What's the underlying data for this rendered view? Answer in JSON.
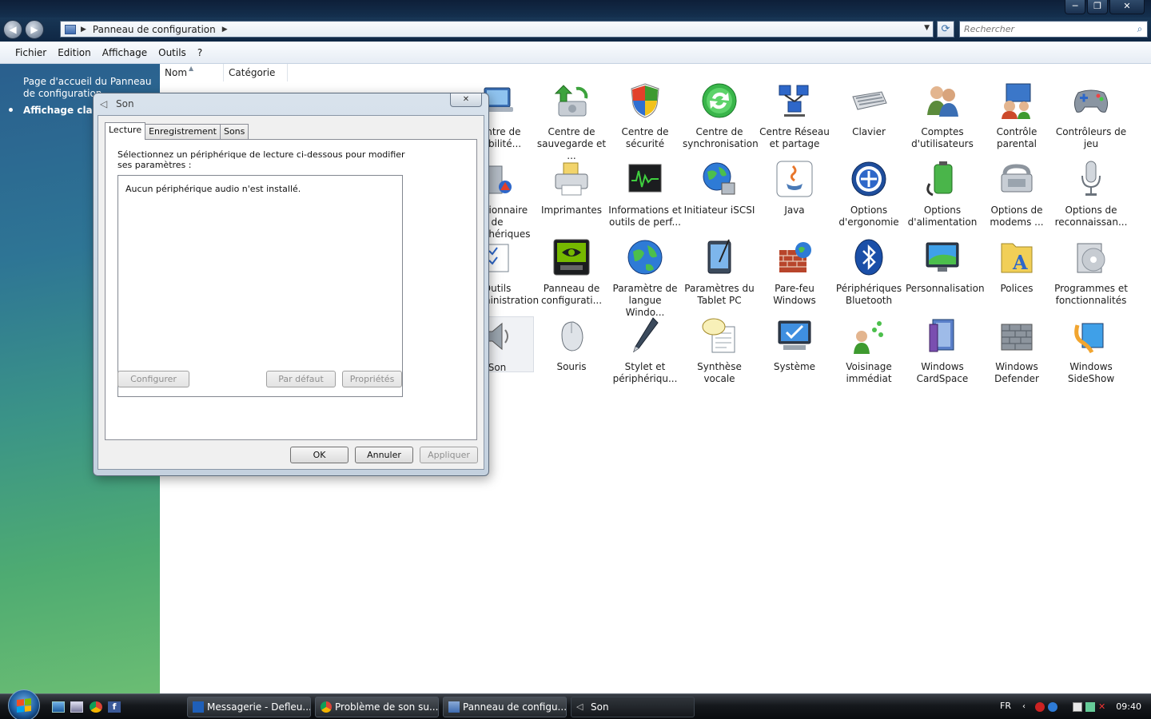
{
  "window": {
    "controls": [
      "─",
      "❐",
      "✕"
    ]
  },
  "address": {
    "path": "Panneau de configuration",
    "search_placeholder": "Rechercher"
  },
  "menu": [
    "Fichier",
    "Edition",
    "Affichage",
    "Outils",
    "?"
  ],
  "sidebar": {
    "home_link": "Page d'accueil du Panneau de configuration",
    "classic_view": "Affichage classique"
  },
  "columns": [
    "Nom",
    "Catégorie"
  ],
  "items": [
    {
      "label": "Centre de mobilité...",
      "icon": "mobility-center-icon"
    },
    {
      "label": "Centre de sauvegarde et ...",
      "icon": "backup-center-icon"
    },
    {
      "label": "Centre de sécurité",
      "icon": "security-shield-icon"
    },
    {
      "label": "Centre de synchronisation",
      "icon": "sync-center-icon"
    },
    {
      "label": "Centre Réseau et partage",
      "icon": "network-center-icon"
    },
    {
      "label": "Clavier",
      "icon": "keyboard-icon"
    },
    {
      "label": "Comptes d'utilisateurs",
      "icon": "user-accounts-icon"
    },
    {
      "label": "Contrôle parental",
      "icon": "parental-control-icon"
    },
    {
      "label": "Contrôleurs de jeu",
      "icon": "gamepad-icon"
    },
    {
      "label": "Gestionnaire de périphériques",
      "icon": "device-manager-icon"
    },
    {
      "label": "Imprimantes",
      "icon": "printer-icon"
    },
    {
      "label": "Informations et outils de perf...",
      "icon": "performance-icon"
    },
    {
      "label": "Initiateur iSCSI",
      "icon": "iscsi-globe-icon"
    },
    {
      "label": "Java",
      "icon": "java-icon"
    },
    {
      "label": "Options d'ergonomie",
      "icon": "ease-of-access-icon"
    },
    {
      "label": "Options d'alimentation",
      "icon": "power-options-icon"
    },
    {
      "label": "Options de modems ...",
      "icon": "modem-phone-icon"
    },
    {
      "label": "Options de reconnaissan...",
      "icon": "microphone-icon"
    },
    {
      "label": "Outils d'administration",
      "icon": "admin-tools-icon"
    },
    {
      "label": "Panneau de configurati...",
      "icon": "nvidia-panel-icon"
    },
    {
      "label": "Paramètre de langue Windo...",
      "icon": "language-globe-icon"
    },
    {
      "label": "Paramètres du Tablet PC",
      "icon": "tablet-pc-icon"
    },
    {
      "label": "Pare-feu Windows",
      "icon": "firewall-icon"
    },
    {
      "label": "Périphériques Bluetooth",
      "icon": "bluetooth-icon"
    },
    {
      "label": "Personnalisation",
      "icon": "personalization-icon"
    },
    {
      "label": "Polices",
      "icon": "fonts-folder-icon"
    },
    {
      "label": "Programmes et fonctionnalités",
      "icon": "programs-icon"
    },
    {
      "label": "Son",
      "icon": "speaker-icon"
    },
    {
      "label": "Souris",
      "icon": "mouse-icon"
    },
    {
      "label": "Stylet et périphériqu...",
      "icon": "pen-icon"
    },
    {
      "label": "Synthèse vocale",
      "icon": "speech-icon"
    },
    {
      "label": "Système",
      "icon": "system-icon"
    },
    {
      "label": "Voisinage immédiat",
      "icon": "people-near-me-icon"
    },
    {
      "label": "Windows CardSpace",
      "icon": "cardspace-icon"
    },
    {
      "label": "Windows Defender",
      "icon": "defender-wall-icon"
    },
    {
      "label": "Windows SideShow",
      "icon": "sideshow-icon"
    }
  ],
  "dialog": {
    "title": "Son",
    "close_label": "✕",
    "tabs": [
      "Lecture",
      "Enregistrement",
      "Sons"
    ],
    "instruction": "Sélectionnez un périphérique de lecture ci-dessous pour modifier ses paramètres :",
    "empty_message": "Aucun périphérique audio n'est installé.",
    "buttons": {
      "configure": "Configurer",
      "default": "Par défaut",
      "properties": "Propriétés",
      "ok": "OK",
      "cancel": "Annuler",
      "apply": "Appliquer"
    }
  },
  "taskbar": {
    "buttons": [
      {
        "label": "Messagerie - Defleu..."
      },
      {
        "label": "Problème de son su..."
      },
      {
        "label": "Panneau de configu..."
      },
      {
        "label": "Son"
      }
    ],
    "language": "FR",
    "clock": "09:40"
  }
}
